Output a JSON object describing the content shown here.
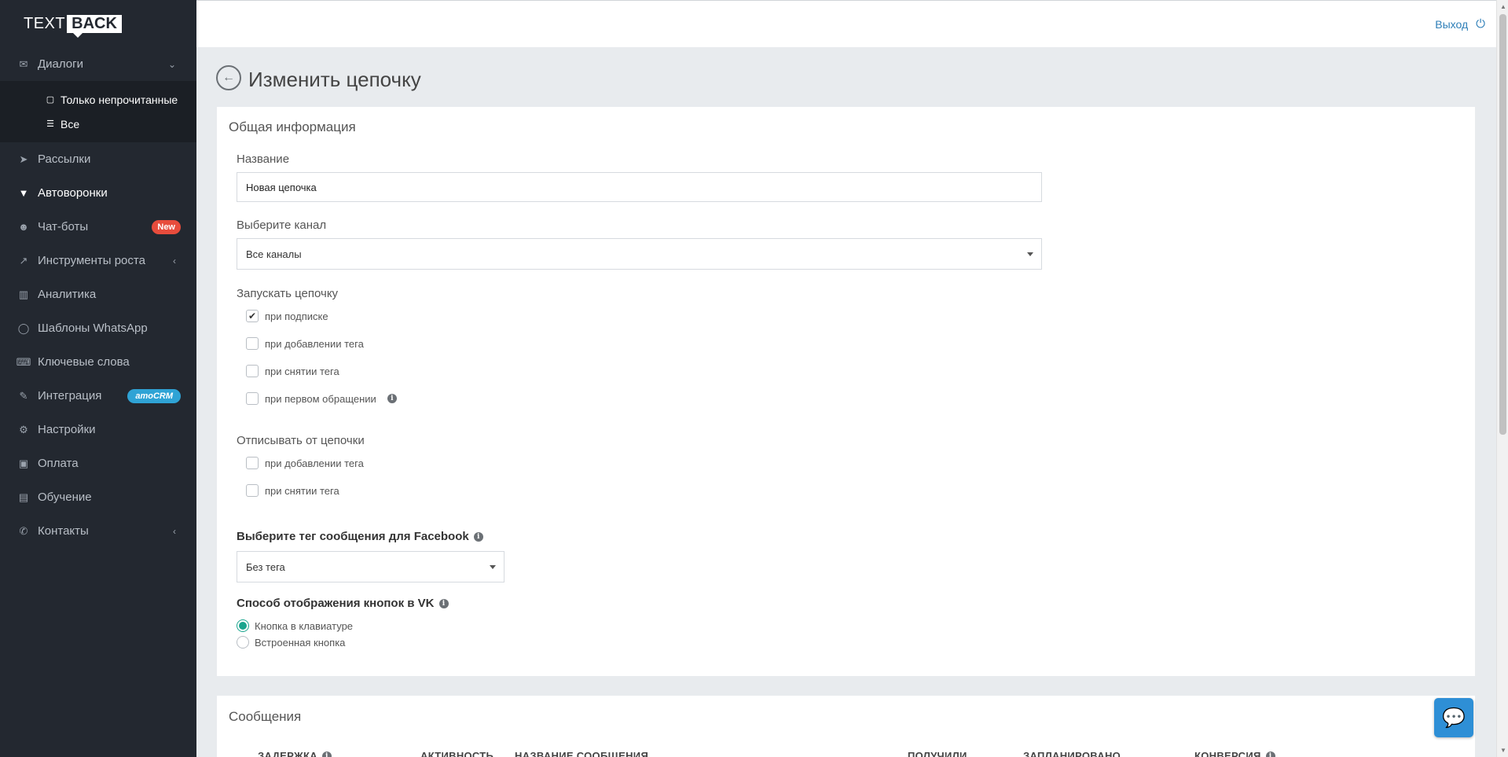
{
  "logo": {
    "text": "TEXT",
    "box": "BACK"
  },
  "sidebar": {
    "dialogs": {
      "label": "Диалоги",
      "icon": "envelope-icon"
    },
    "dialogs_sub": [
      {
        "label": "Только непрочитанные",
        "icon": "square-icon"
      },
      {
        "label": "Все",
        "icon": "list-icon"
      }
    ],
    "items": [
      {
        "label": "Рассылки",
        "icon": "paper-plane-icon"
      },
      {
        "label": "Автоворонки",
        "icon": "filter-icon"
      },
      {
        "label": "Чат-боты",
        "icon": "robot-icon",
        "badge": "New"
      },
      {
        "label": "Инструменты роста",
        "icon": "chart-line-icon"
      },
      {
        "label": "Аналитика",
        "icon": "bar-chart-icon"
      },
      {
        "label": "Шаблоны WhatsApp",
        "icon": "comment-icon"
      },
      {
        "label": "Ключевые слова",
        "icon": "keyboard-icon"
      },
      {
        "label": "Интеграция",
        "icon": "plug-icon",
        "badge": "amoCRM"
      },
      {
        "label": "Настройки",
        "icon": "cogs-icon"
      },
      {
        "label": "Оплата",
        "icon": "money-icon"
      },
      {
        "label": "Обучение",
        "icon": "book-icon"
      },
      {
        "label": "Контакты",
        "icon": "phone-icon"
      }
    ]
  },
  "topbar": {
    "logout_label": "Выход"
  },
  "page": {
    "title": "Изменить цепочку"
  },
  "general": {
    "title": "Общая информация",
    "name_label": "Название",
    "name_value": "Новая цепочка",
    "channel_label": "Выберите канал",
    "channel_value": "Все каналы",
    "start_label": "Запускать цепочку",
    "start_options": [
      {
        "label": "при подписке",
        "checked": true
      },
      {
        "label": "при добавлении тега",
        "checked": false
      },
      {
        "label": "при снятии тега",
        "checked": false
      },
      {
        "label": "при первом обращении",
        "checked": false
      }
    ],
    "unsubscribe_label": "Отписывать от цепочки",
    "unsubscribe_options": [
      {
        "label": "при добавлении тега",
        "checked": false
      },
      {
        "label": "при снятии тега",
        "checked": false
      }
    ],
    "fb_tag_label": "Выберите тег сообщения для Facebook",
    "fb_tag_value": "Без тега",
    "vk_label": "Способ отображения кнопок в VK",
    "vk_options": [
      {
        "label": "Кнопка в клавиатуре",
        "selected": true
      },
      {
        "label": "Встроенная кнопка",
        "selected": false
      }
    ]
  },
  "messages": {
    "title": "Сообщения",
    "columns": [
      "ЗАДЕРЖКА",
      "АКТИВНОСТЬ",
      "НАЗВАНИЕ СООБЩЕНИЯ",
      "ПОЛУЧИЛИ",
      "ЗАПЛАНИРОВАНО",
      "КОНВЕРСИЯ"
    ]
  },
  "colors": {
    "sidebar_bg": "#232830",
    "accent": "#1aa58e",
    "link": "#2f7fb8",
    "badge_new": "#e74c3c",
    "badge_amo": "#2fa3d5"
  }
}
